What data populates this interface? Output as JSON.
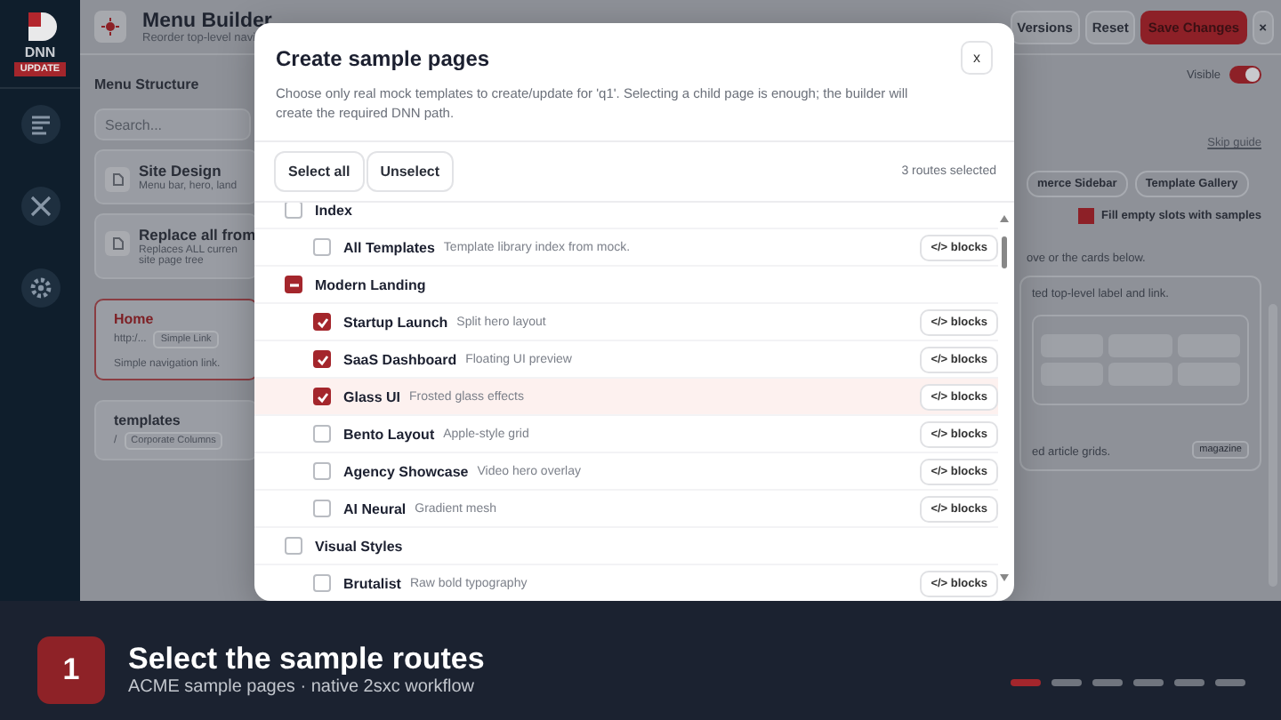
{
  "sidebar": {
    "logo": "DNN",
    "badge": "UPDATE"
  },
  "header": {
    "title": "Menu Builder",
    "subtitle": "Reorder top-level navi",
    "buttons": [
      {
        "label": "Versions",
        "kind": "plain"
      },
      {
        "label": "Reset",
        "kind": "plain"
      },
      {
        "label": "Save Changes",
        "kind": "primary"
      },
      {
        "label": "×",
        "kind": "close"
      }
    ]
  },
  "left_panel": {
    "title": "Menu Structure",
    "search": {
      "placeholder": "Search..."
    },
    "actions": [
      {
        "title": "Site Design",
        "desc": "Menu bar, hero, land"
      },
      {
        "title": "Replace all from",
        "desc": "Replaces ALL curren site page tree"
      }
    ],
    "items": [
      {
        "title": "Home",
        "url": "http:/...",
        "tag": "Simple Link",
        "note": "Simple navigation link.",
        "selected": true
      },
      {
        "title": "templates",
        "url": "/",
        "tag": "Corporate Columns",
        "selected": false
      }
    ]
  },
  "right_panel": {
    "visible_label": "Visible",
    "visible_on": true,
    "skip_guide": "Skip guide",
    "chips": [
      "merce Sidebar",
      "Template Gallery"
    ],
    "fill_label": "Fill empty slots with samples",
    "fill_checked": true,
    "hint": "ove or the cards below.",
    "card_text": "ted top-level label and link.",
    "card2_text": "ed article grids.",
    "card2_tag": "magazine"
  },
  "modal": {
    "title": "Create sample pages",
    "desc": "Choose only real mock templates to create/update for 'q1'. Selecting a child page is enough; the builder will create the required DNN path.",
    "close": "x",
    "select_all": "Select all",
    "unselect": "Unselect",
    "count": "3 routes selected",
    "groups": [
      {
        "name": "Index",
        "checked": false,
        "indeterminate": false,
        "children": [
          {
            "name": "All Templates",
            "desc": "Template library index from mock.",
            "checked": false,
            "highlighted": false,
            "action": "</> blocks"
          }
        ]
      },
      {
        "name": "Modern Landing",
        "checked": true,
        "indeterminate": true,
        "children": [
          {
            "name": "Startup Launch",
            "desc": "Split hero layout",
            "checked": true,
            "highlighted": false,
            "action": "</> blocks"
          },
          {
            "name": "SaaS Dashboard",
            "desc": "Floating UI preview",
            "checked": true,
            "highlighted": false,
            "action": "</> blocks"
          },
          {
            "name": "Glass UI",
            "desc": "Frosted glass effects",
            "checked": true,
            "highlighted": true,
            "action": "</> blocks"
          },
          {
            "name": "Bento Layout",
            "desc": "Apple-style grid",
            "checked": false,
            "highlighted": false,
            "action": "</> blocks"
          },
          {
            "name": "Agency Showcase",
            "desc": "Video hero overlay",
            "checked": false,
            "highlighted": false,
            "action": "</> blocks"
          },
          {
            "name": "AI Neural",
            "desc": "Gradient mesh",
            "checked": false,
            "highlighted": false,
            "action": "</> blocks"
          }
        ]
      },
      {
        "name": "Visual Styles",
        "checked": false,
        "indeterminate": false,
        "children": [
          {
            "name": "Brutalist",
            "desc": "Raw bold typography",
            "checked": false,
            "highlighted": false,
            "action": "</> blocks"
          }
        ]
      }
    ]
  },
  "caption": {
    "step": "1",
    "title": "Select the sample routes",
    "subtitle": "ACME sample pages · native 2sxc workflow",
    "steps": [
      {
        "selected": true
      },
      {
        "selected": false
      },
      {
        "selected": false
      },
      {
        "selected": false
      },
      {
        "selected": false
      },
      {
        "selected": false
      }
    ]
  }
}
